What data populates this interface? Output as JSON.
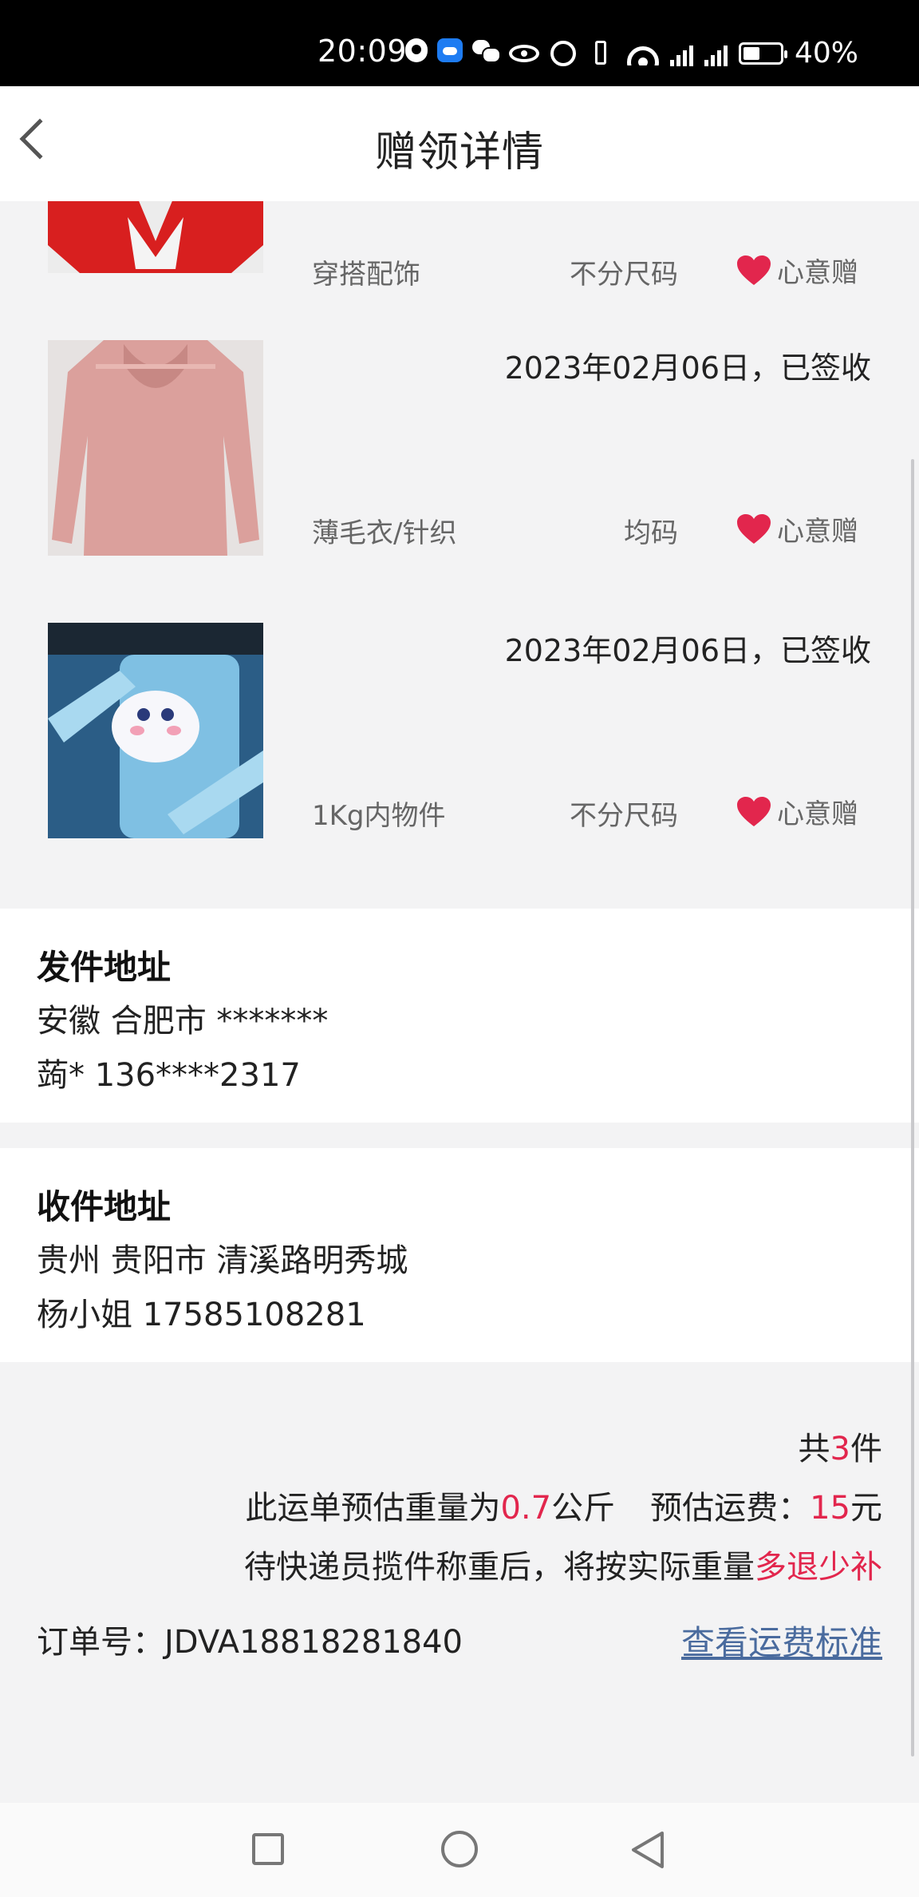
{
  "status_bar": {
    "time": "20:09",
    "battery": "40%",
    "icons": [
      "qq-icon",
      "cloud-icon",
      "wechat-icon",
      "eye-icon",
      "alarm-icon",
      "vibrate-icon",
      "wifi-icon",
      "signal-4g-icon",
      "signal-4g-icon",
      "battery-saver-icon"
    ]
  },
  "header": {
    "title": "赠领详情",
    "back_icon": "chevron-left-icon"
  },
  "items": [
    {
      "date": "",
      "category": "穿搭配饰",
      "size": "不分尺码",
      "gift_label": "心意赠",
      "thumb": "red-clothing"
    },
    {
      "date": "2023年02月06日，已签收",
      "category": "薄毛衣/针织",
      "size": "均码",
      "gift_label": "心意赠",
      "thumb": "pink-sweater"
    },
    {
      "date": "2023年02月06日，已签收",
      "category": "1Kg内物件",
      "size": "不分尺码",
      "gift_label": "心意赠",
      "thumb": "blue-phone-case"
    }
  ],
  "sender": {
    "title": "发件地址",
    "address": "安徽 合肥市 *******",
    "contact": "蒟* 136****2317"
  },
  "receiver": {
    "title": "收件地址",
    "address": "贵州 贵阳市 清溪路明秀城",
    "contact": "杨小姐 17585108281"
  },
  "summary": {
    "count_prefix": "共",
    "count": "3",
    "count_suffix": "件",
    "weight_prefix": "此运单预估重量为",
    "weight": "0.7",
    "weight_unit": "公斤",
    "fee_prefix": "预估运费：",
    "fee": "15",
    "fee_unit": "元",
    "note_prefix": "待快递员揽件称重后，将按实际重量",
    "note_accent": "多退少补",
    "order_label": "订单号：",
    "order_no": "JDVA18818281840",
    "fee_link": "查看运费标准"
  },
  "colors": {
    "accent": "#e2264d",
    "link": "#4a6b9e",
    "heart": "#e2264d"
  }
}
